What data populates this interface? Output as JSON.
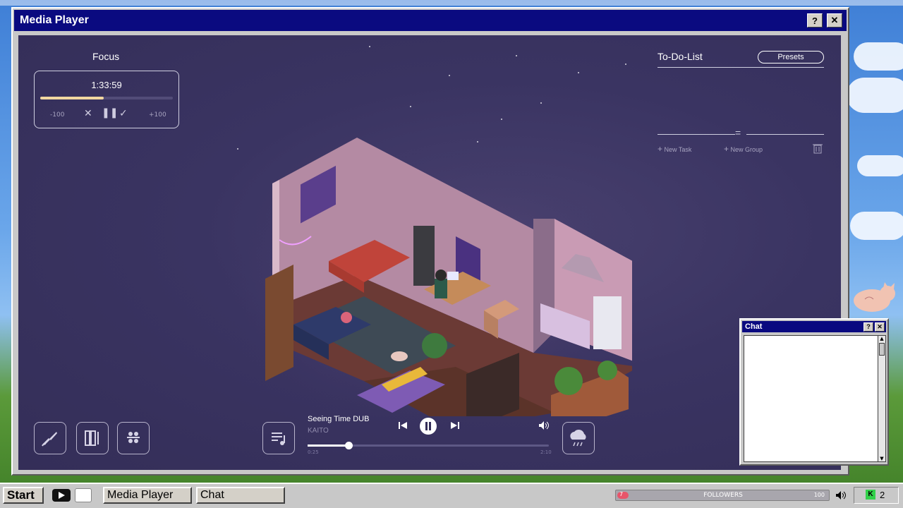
{
  "window": {
    "title": "Media Player",
    "help": "?",
    "close": "✕"
  },
  "focus": {
    "title": "Focus",
    "timer": "1:33:59",
    "progress": 0.48,
    "minus_label": "-100",
    "plus_label": "+100"
  },
  "todo": {
    "title": "To-Do-List",
    "presets_label": "Presets",
    "new_task_label": "New Task",
    "new_group_label": "New Group"
  },
  "player": {
    "track_title": "Seeing Time DUB",
    "artist": "KAITO",
    "elapsed": "0:25",
    "duration": "2:10",
    "progress": 0.17
  },
  "chat": {
    "title": "Chat",
    "help": "?",
    "close": "✕"
  },
  "taskbar": {
    "start_label": "Start",
    "items": [
      {
        "label": "Media Player"
      },
      {
        "label": "Chat"
      }
    ],
    "followers_label": "FOLLOWERS",
    "followers_current": "7",
    "followers_goal": "100",
    "tray_count": "2"
  },
  "colors": {
    "titlebar": "#0a0a80",
    "scene_bg": "#3a3462",
    "accent_bar": "#f1d7a0",
    "followers_fill": "#e8556a"
  }
}
